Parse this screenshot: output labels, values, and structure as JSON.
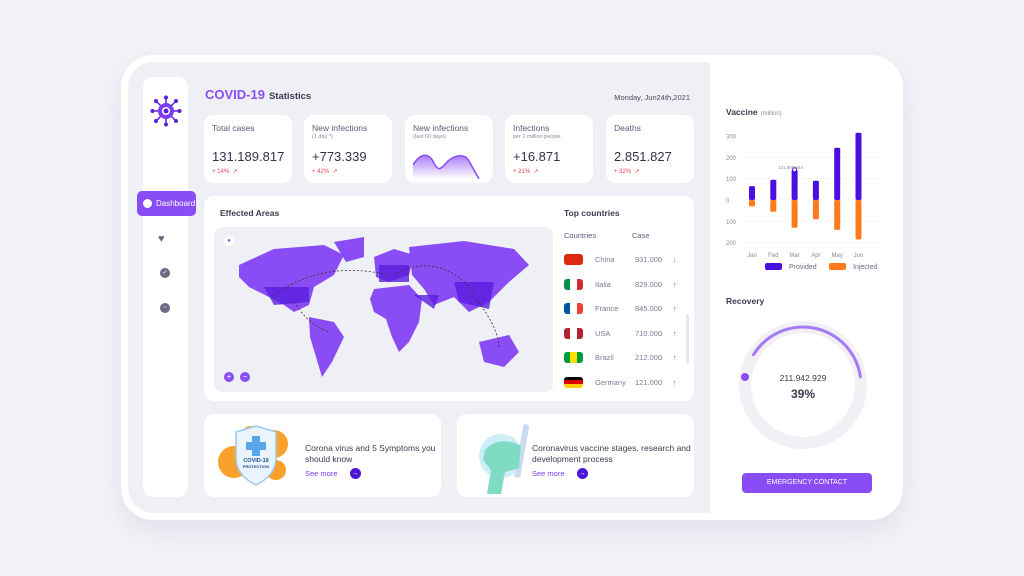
{
  "header": {
    "title_accent": "COVID-19",
    "title_rest": "Statistics",
    "date": "Monday, Jun24th,2021"
  },
  "sidebar": {
    "items": [
      {
        "label": "Dashboard",
        "icon": "chat-icon",
        "active": true
      },
      {
        "icon": "heart-icon"
      },
      {
        "icon": "check-circle-icon"
      },
      {
        "icon": "activity-icon"
      }
    ]
  },
  "stats": [
    {
      "title": "Total cases",
      "sub": "",
      "value": "131.189.817",
      "change": "+ 14%"
    },
    {
      "title": "New infections",
      "sub": "(1 day *)",
      "value": "+773.339",
      "change": "+ 42%"
    },
    {
      "title": "New infections",
      "sub": "(last 60 days)",
      "value": "",
      "change": ""
    },
    {
      "title": "Infections",
      "sub": "per 1 million people",
      "value": "+16.871",
      "change": "+ 21%"
    },
    {
      "title": "Deaths",
      "sub": "",
      "value": "2.851.827",
      "change": "+ 32%"
    }
  ],
  "map": {
    "title": "Effected Areas"
  },
  "top_countries": {
    "title": "Top countries",
    "col_country": "Countries",
    "col_case": "Case",
    "rows": [
      {
        "country": "China",
        "case": "931.000",
        "trend": "down"
      },
      {
        "country": "Italia",
        "case": "829.000",
        "trend": "up"
      },
      {
        "country": "France",
        "case": "845.000",
        "trend": "up"
      },
      {
        "country": "USA",
        "case": "710.000",
        "trend": "up"
      },
      {
        "country": "Brazil",
        "case": "212.000",
        "trend": "up"
      },
      {
        "country": "Germany",
        "case": "121.000",
        "trend": "up"
      }
    ]
  },
  "articles": [
    {
      "title": "Corona virus and 5 Symptoms you should know",
      "link": "See more",
      "badge_line1": "COVID-19",
      "badge_line2": "PROTECTION"
    },
    {
      "title": "Coronavirus vaccine stages, research and development process",
      "link": "See more"
    }
  ],
  "vaccine": {
    "title": "Vaccine",
    "unit": "(million)"
  },
  "chart_data": {
    "type": "bar",
    "categories": [
      "Jan",
      "Fed",
      "Mar",
      "Apr",
      "May",
      "Jun"
    ],
    "series": [
      {
        "name": "Provided",
        "values": [
          65,
          95,
          141.67,
          90,
          245,
          315
        ],
        "color": "#4a10e0"
      },
      {
        "name": "Injected",
        "values": [
          30,
          55,
          130,
          90,
          140,
          185
        ],
        "color": "#ff7a1a"
      }
    ],
    "y_ticks": [
      "300",
      "200",
      "100",
      "0",
      "100",
      "200"
    ],
    "ylim": [
      -200,
      300
    ],
    "annotation": "141.669.944",
    "legend": "bottom"
  },
  "recovery": {
    "title": "Recovery",
    "value": "211.942.929",
    "percent": "39%",
    "fraction": 0.39
  },
  "emergency_button": "EMERGENCY CONTACT",
  "colors": {
    "accent": "#8a4cf5",
    "up": "#e2454f",
    "down": "#35c24a"
  }
}
